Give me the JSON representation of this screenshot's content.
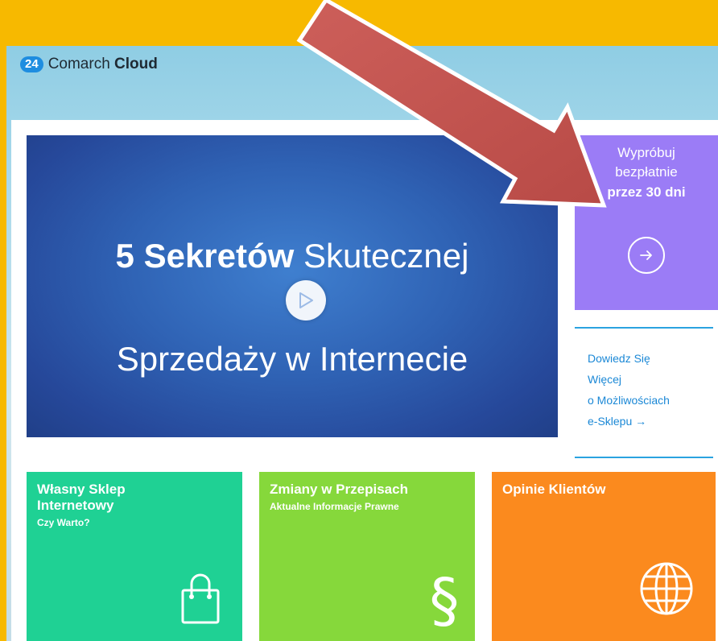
{
  "header": {
    "logo_badge": "24",
    "logo_prefix": "Comarch ",
    "logo_strong": "Cloud"
  },
  "video": {
    "title_bold": "5 Sekretów",
    "title_rest": " Skutecznej",
    "title_line2": "Sprzedaży w Internecie",
    "play_icon": "play-icon"
  },
  "trial": {
    "line1": "Wypróbuj",
    "line2": "bezpłatnie",
    "line3": "przez 30 dni",
    "icon": "arrow-right-circle-icon"
  },
  "learn_more": {
    "line1": "Dowiedz Się",
    "line2": "Więcej",
    "line3": "o Możliwościach",
    "line4": "e-Sklepu →"
  },
  "tiles": [
    {
      "title_l1": "Własny Sklep",
      "title_l2": "Internetowy",
      "subtitle": "Czy Warto?",
      "icon": "shopping-bag-icon",
      "color": "#1fd194"
    },
    {
      "title_l1": "Zmiany w Przepisach",
      "subtitle": "Aktualne Informacje Prawne",
      "icon": "section-sign-icon",
      "color": "#86d83b"
    },
    {
      "title_l1": "Opinie Klientów",
      "icon": "globe-icon",
      "color": "#fb8a1e"
    }
  ],
  "colors": {
    "background": "#f7b900",
    "trial": "#9b7cf6",
    "link": "#1b88d6",
    "annotation_arrow": "#c0504d"
  }
}
